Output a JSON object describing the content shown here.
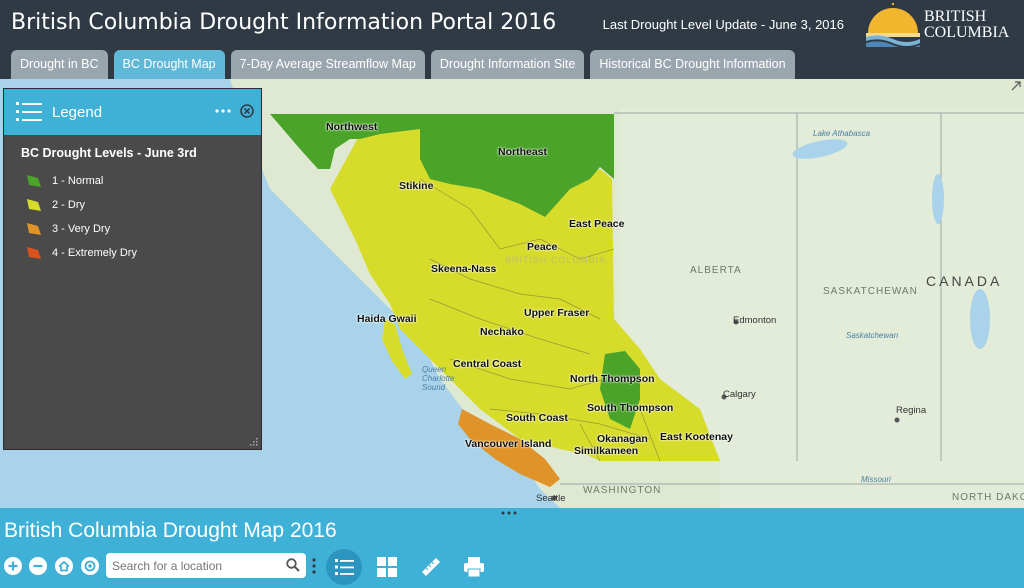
{
  "header": {
    "title": "British Columbia Drought Information Portal 2016",
    "update_text": "Last Drought Level Update - June 3, 2016",
    "logo_line1": "BRITISH",
    "logo_line2": "COLUMBIA"
  },
  "tabs": [
    {
      "label": "Drought in BC",
      "active": false
    },
    {
      "label": "BC Drought Map",
      "active": true
    },
    {
      "label": "7-Day Average Streamflow Map",
      "active": false
    },
    {
      "label": "Drought Information Site",
      "active": false
    },
    {
      "label": "Historical BC Drought Information",
      "active": false
    }
  ],
  "legend": {
    "title": "Legend",
    "subtitle": "BC Drought Levels - June 3rd",
    "items": [
      {
        "label": "1 - Normal",
        "color": "#4ba32a"
      },
      {
        "label": "2 - Dry",
        "color": "#d7dc2a"
      },
      {
        "label": "3 - Very Dry",
        "color": "#e09328"
      },
      {
        "label": "4 - Extremely Dry",
        "color": "#d9531e"
      }
    ]
  },
  "map": {
    "regions": [
      "Northwest",
      "Northeast",
      "Stikine",
      "East Peace",
      "Peace",
      "Skeena-Nass",
      "Upper Fraser",
      "Haida Gwaii",
      "Nechako",
      "Central Coast",
      "North Thompson",
      "South Thompson",
      "South Coast",
      "Vancouver Island",
      "Okanagan",
      "Similkameen",
      "East Kootenay"
    ],
    "geo_labels": [
      "ALBERTA",
      "SASKATCHEWAN",
      "CANADA",
      "WASHINGTON",
      "NORTH DAKOTA",
      "BRITISH COLUMBIA",
      "Lake Athabasca",
      "Saskatchewan",
      "Missouri",
      "Queen Charlotte Sound"
    ],
    "cities": [
      "Edmonton",
      "Calgary",
      "Regina",
      "Seattle"
    ]
  },
  "footer": {
    "map_title": "British Columbia Drought Map 2016",
    "search_placeholder": "Search for a location"
  }
}
